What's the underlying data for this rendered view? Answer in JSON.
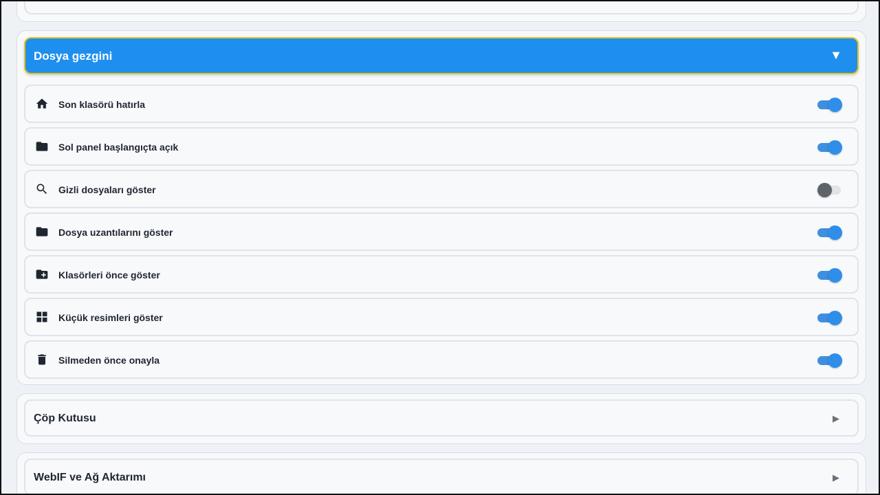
{
  "file_manager": {
    "title": "Dosya gezgini",
    "chevron": "▼",
    "settings": [
      {
        "label": "Son klasörü hatırla",
        "icon": "home-icon",
        "enabled": true
      },
      {
        "label": "Sol panel başlangıçta açık",
        "icon": "folder-icon",
        "enabled": true
      },
      {
        "label": "Gizli dosyaları göster",
        "icon": "search-icon",
        "enabled": false
      },
      {
        "label": "Dosya uzantılarını göster",
        "icon": "folder-icon",
        "enabled": true
      },
      {
        "label": "Klasörleri önce göster",
        "icon": "folder-plus-icon",
        "enabled": true
      },
      {
        "label": "Küçük resimleri göster",
        "icon": "grid-icon",
        "enabled": true
      },
      {
        "label": "Silmeden önce onayla",
        "icon": "trash-icon",
        "enabled": true
      }
    ]
  },
  "trash": {
    "title": "Çöp Kutusu",
    "chevron": "▶"
  },
  "webif": {
    "title": "WebIF ve Ağ Aktarımı",
    "chevron": "▶"
  },
  "colors": {
    "accent": "#1e8fef",
    "focus_border": "#e3c21c",
    "toggle_on": "#2f8ee8",
    "toggle_off_knob": "#5e6368"
  }
}
